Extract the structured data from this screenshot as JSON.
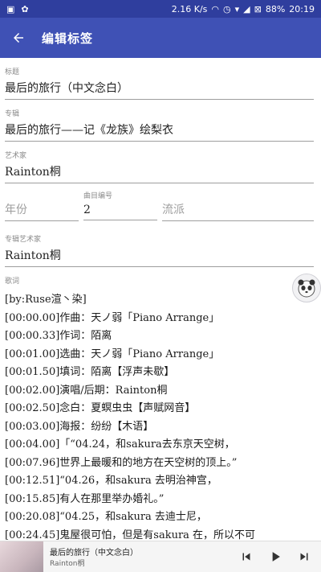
{
  "status_bar": {
    "speed": "2.16 K/s",
    "battery": "88%",
    "time": "20:19"
  },
  "app_bar": {
    "title": "编辑标签"
  },
  "fields": {
    "title": {
      "label": "标题",
      "value": "最后的旅行（中文念白）"
    },
    "album": {
      "label": "专辑",
      "value": "最后的旅行——记《龙族》绘梨衣"
    },
    "artist": {
      "label": "艺术家",
      "value": "Rainton桐"
    },
    "year": {
      "label": "",
      "placeholder": "年份",
      "value": ""
    },
    "track": {
      "label": "曲目编号",
      "value": "2"
    },
    "genre": {
      "label": "",
      "placeholder": "流派",
      "value": ""
    },
    "album_artist": {
      "label": "专辑艺术家",
      "value": "Rainton桐"
    },
    "lyrics": {
      "label": "歌词",
      "lines": [
        "[by:Ruse渲丶染]",
        "[00:00.00]作曲：天ノ弱「Piano Arrange」",
        "[00:00.33]作词：陌离",
        "[00:01.00]选曲：天ノ弱「Piano Arrange」",
        "[00:01.50]填词：陌离【浮声未歇】",
        "[00:02.00]演唱/后期：Rainton桐",
        "[00:02.50]念白：夏螟虫虫【声赋网音】",
        "[00:03.00]海报：纷纷【木语】",
        "[00:04.00]「“04.24，和sakura去东京天空树，",
        "[00:07.96]世界上最暖和的地方在天空树的顶上。”",
        "[00:12.51]“04.26，和sakura 去明治神宫，",
        "[00:15.85]有人在那里举办婚礼。”",
        "[00:20.08]“04.25，和sakura 去迪士尼，",
        "[00:24.45]鬼屋很可怕，但是有sakura 在，所以不可"
      ]
    }
  },
  "player": {
    "title": "最后的旅行（中文念白）",
    "artist": "Rainton桐"
  },
  "colors": {
    "status_bar": "#2f3e9e",
    "app_bar": "#3f51b5",
    "underline": "#9e9e9e"
  }
}
